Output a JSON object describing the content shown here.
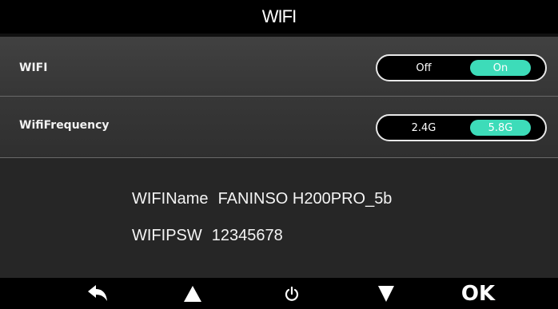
{
  "header": {
    "title": "WIFI"
  },
  "settings": [
    {
      "label": "WIFI",
      "options": [
        "Off",
        "On"
      ],
      "selected": "On"
    },
    {
      "label": "WifiFrequency",
      "options": [
        "2.4G",
        "5.8G"
      ],
      "selected": "5.8G"
    }
  ],
  "info": {
    "name_label": "WIFIName",
    "name_value": "FANINSO H200PRO_5b",
    "psw_label": "WIFIPSW",
    "psw_value": "12345678"
  },
  "footer": {
    "buttons": [
      {
        "icon": "back-arrow-icon"
      },
      {
        "icon": "up-triangle-icon"
      },
      {
        "icon": "power-icon"
      },
      {
        "icon": "down-triangle-icon"
      },
      {
        "label": "OK"
      }
    ]
  },
  "colors": {
    "accent": "#3ddcb9",
    "background": "#111111",
    "bar": "#000000"
  }
}
